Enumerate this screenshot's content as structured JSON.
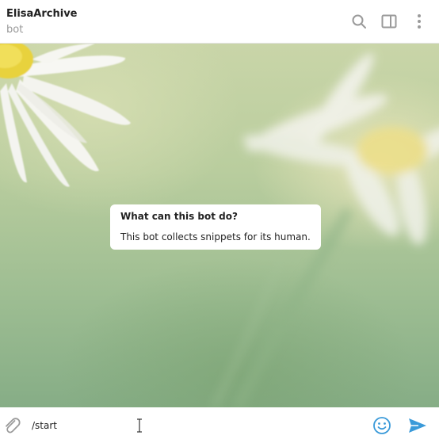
{
  "header": {
    "title": "ElisaArchive",
    "subtitle": "bot",
    "icons": [
      "search-icon",
      "sidebar-toggle-icon",
      "more-vertical-icon"
    ]
  },
  "bot_info": {
    "title": "What can this bot do?",
    "description": "This bot collects snippets for its human."
  },
  "composer": {
    "input_value": "/start",
    "icons": [
      "attach-icon",
      "emoji-icon",
      "send-icon"
    ]
  },
  "colors": {
    "accent": "#3a9ad9",
    "header_bg": "#ffffff",
    "icon_gray": "#9a9a9a"
  }
}
